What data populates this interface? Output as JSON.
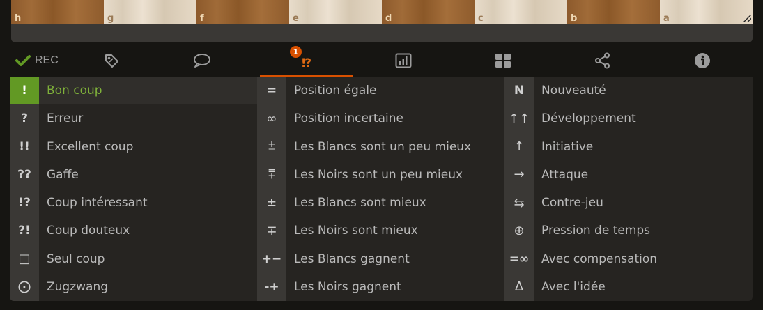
{
  "board": {
    "files": [
      "h",
      "g",
      "f",
      "e",
      "d",
      "c",
      "b",
      "a"
    ],
    "shades": [
      "dark",
      "light",
      "dark",
      "light",
      "dark",
      "light",
      "dark",
      "light"
    ]
  },
  "tabs": {
    "rec_label": "REC",
    "glyph_badge": "1",
    "glyph_label": "⁉",
    "active": "glyphs",
    "accent_color": "#d85000",
    "rec_check_color": "#629924"
  },
  "glyph_columns": [
    {
      "name": "move_annotations",
      "items": [
        {
          "symbol": "!",
          "label": "Bon coup",
          "selected": true
        },
        {
          "symbol": "?",
          "label": "Erreur"
        },
        {
          "symbol": "!!",
          "label": "Excellent coup"
        },
        {
          "symbol": "??",
          "label": "Gaffe"
        },
        {
          "symbol": "!?",
          "label": "Coup intéressant"
        },
        {
          "symbol": "?!",
          "label": "Coup douteux"
        },
        {
          "symbol": "□",
          "label": "Seul coup"
        },
        {
          "symbol": "⨀",
          "label": "Zugzwang"
        }
      ]
    },
    {
      "name": "position_evaluations",
      "items": [
        {
          "symbol": "=",
          "label": "Position égale"
        },
        {
          "symbol": "∞",
          "label": "Position incertaine"
        },
        {
          "symbol": "⩲",
          "label": "Les Blancs sont un peu mieux"
        },
        {
          "symbol": "⩱",
          "label": "Les Noirs sont un peu mieux"
        },
        {
          "symbol": "±",
          "label": "Les Blancs sont mieux"
        },
        {
          "symbol": "∓",
          "label": "Les Noirs sont mieux"
        },
        {
          "symbol": "+−",
          "label": "Les Blancs gagnent"
        },
        {
          "symbol": "-+",
          "label": "Les Noirs gagnent"
        }
      ]
    },
    {
      "name": "observations",
      "items": [
        {
          "symbol": "N",
          "label": "Nouveauté"
        },
        {
          "symbol": "↑↑",
          "label": "Développement"
        },
        {
          "symbol": "↑",
          "label": "Initiative"
        },
        {
          "symbol": "→",
          "label": "Attaque"
        },
        {
          "symbol": "⇆",
          "label": "Contre-jeu"
        },
        {
          "symbol": "⊕",
          "label": "Pression de temps"
        },
        {
          "symbol": "=∞",
          "label": "Avec compensation"
        },
        {
          "symbol": "∆",
          "label": "Avec l'idée"
        }
      ]
    }
  ]
}
